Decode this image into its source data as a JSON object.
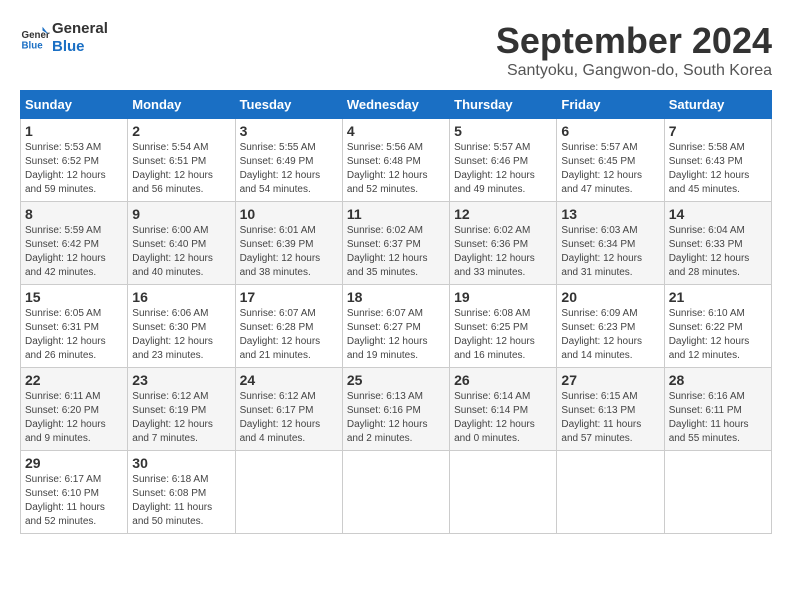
{
  "header": {
    "logo_line1": "General",
    "logo_line2": "Blue",
    "month_title": "September 2024",
    "location": "Santyoku, Gangwon-do, South Korea"
  },
  "weekdays": [
    "Sunday",
    "Monday",
    "Tuesday",
    "Wednesday",
    "Thursday",
    "Friday",
    "Saturday"
  ],
  "weeks": [
    [
      {
        "day": "1",
        "sunrise": "5:53 AM",
        "sunset": "6:52 PM",
        "daylight": "12 hours and 59 minutes."
      },
      {
        "day": "2",
        "sunrise": "5:54 AM",
        "sunset": "6:51 PM",
        "daylight": "12 hours and 56 minutes."
      },
      {
        "day": "3",
        "sunrise": "5:55 AM",
        "sunset": "6:49 PM",
        "daylight": "12 hours and 54 minutes."
      },
      {
        "day": "4",
        "sunrise": "5:56 AM",
        "sunset": "6:48 PM",
        "daylight": "12 hours and 52 minutes."
      },
      {
        "day": "5",
        "sunrise": "5:57 AM",
        "sunset": "6:46 PM",
        "daylight": "12 hours and 49 minutes."
      },
      {
        "day": "6",
        "sunrise": "5:57 AM",
        "sunset": "6:45 PM",
        "daylight": "12 hours and 47 minutes."
      },
      {
        "day": "7",
        "sunrise": "5:58 AM",
        "sunset": "6:43 PM",
        "daylight": "12 hours and 45 minutes."
      }
    ],
    [
      {
        "day": "8",
        "sunrise": "5:59 AM",
        "sunset": "6:42 PM",
        "daylight": "12 hours and 42 minutes."
      },
      {
        "day": "9",
        "sunrise": "6:00 AM",
        "sunset": "6:40 PM",
        "daylight": "12 hours and 40 minutes."
      },
      {
        "day": "10",
        "sunrise": "6:01 AM",
        "sunset": "6:39 PM",
        "daylight": "12 hours and 38 minutes."
      },
      {
        "day": "11",
        "sunrise": "6:02 AM",
        "sunset": "6:37 PM",
        "daylight": "12 hours and 35 minutes."
      },
      {
        "day": "12",
        "sunrise": "6:02 AM",
        "sunset": "6:36 PM",
        "daylight": "12 hours and 33 minutes."
      },
      {
        "day": "13",
        "sunrise": "6:03 AM",
        "sunset": "6:34 PM",
        "daylight": "12 hours and 31 minutes."
      },
      {
        "day": "14",
        "sunrise": "6:04 AM",
        "sunset": "6:33 PM",
        "daylight": "12 hours and 28 minutes."
      }
    ],
    [
      {
        "day": "15",
        "sunrise": "6:05 AM",
        "sunset": "6:31 PM",
        "daylight": "12 hours and 26 minutes."
      },
      {
        "day": "16",
        "sunrise": "6:06 AM",
        "sunset": "6:30 PM",
        "daylight": "12 hours and 23 minutes."
      },
      {
        "day": "17",
        "sunrise": "6:07 AM",
        "sunset": "6:28 PM",
        "daylight": "12 hours and 21 minutes."
      },
      {
        "day": "18",
        "sunrise": "6:07 AM",
        "sunset": "6:27 PM",
        "daylight": "12 hours and 19 minutes."
      },
      {
        "day": "19",
        "sunrise": "6:08 AM",
        "sunset": "6:25 PM",
        "daylight": "12 hours and 16 minutes."
      },
      {
        "day": "20",
        "sunrise": "6:09 AM",
        "sunset": "6:23 PM",
        "daylight": "12 hours and 14 minutes."
      },
      {
        "day": "21",
        "sunrise": "6:10 AM",
        "sunset": "6:22 PM",
        "daylight": "12 hours and 12 minutes."
      }
    ],
    [
      {
        "day": "22",
        "sunrise": "6:11 AM",
        "sunset": "6:20 PM",
        "daylight": "12 hours and 9 minutes."
      },
      {
        "day": "23",
        "sunrise": "6:12 AM",
        "sunset": "6:19 PM",
        "daylight": "12 hours and 7 minutes."
      },
      {
        "day": "24",
        "sunrise": "6:12 AM",
        "sunset": "6:17 PM",
        "daylight": "12 hours and 4 minutes."
      },
      {
        "day": "25",
        "sunrise": "6:13 AM",
        "sunset": "6:16 PM",
        "daylight": "12 hours and 2 minutes."
      },
      {
        "day": "26",
        "sunrise": "6:14 AM",
        "sunset": "6:14 PM",
        "daylight": "12 hours and 0 minutes."
      },
      {
        "day": "27",
        "sunrise": "6:15 AM",
        "sunset": "6:13 PM",
        "daylight": "11 hours and 57 minutes."
      },
      {
        "day": "28",
        "sunrise": "6:16 AM",
        "sunset": "6:11 PM",
        "daylight": "11 hours and 55 minutes."
      }
    ],
    [
      {
        "day": "29",
        "sunrise": "6:17 AM",
        "sunset": "6:10 PM",
        "daylight": "11 hours and 52 minutes."
      },
      {
        "day": "30",
        "sunrise": "6:18 AM",
        "sunset": "6:08 PM",
        "daylight": "11 hours and 50 minutes."
      },
      null,
      null,
      null,
      null,
      null
    ]
  ]
}
